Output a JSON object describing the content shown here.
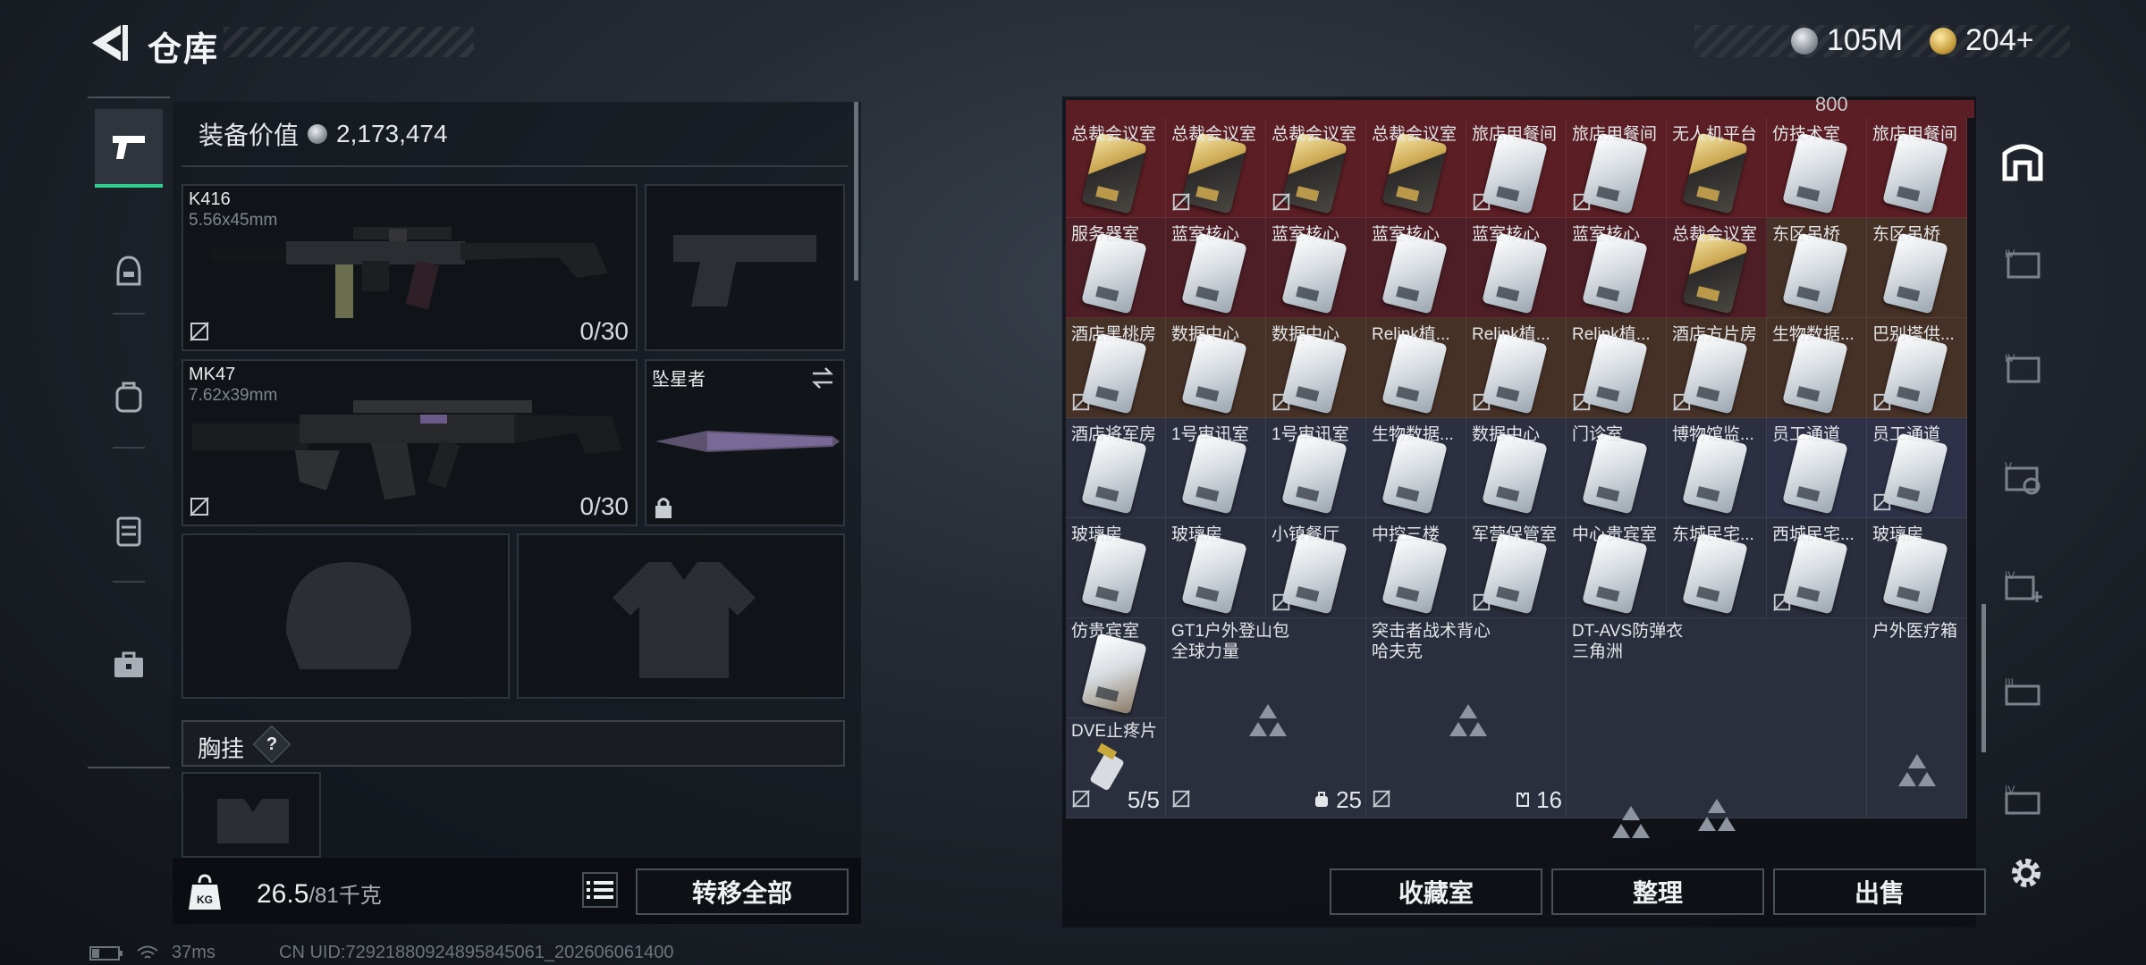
{
  "header": {
    "title": "仓库",
    "silver_amount": "105M",
    "gold_amount": "204+"
  },
  "equipment": {
    "value_label": "装备价值",
    "value": "2,173,474",
    "weapon1": {
      "name": "K416",
      "caliber": "5.56x45mm",
      "ammo": "0/30"
    },
    "weapon2": {
      "name": "MK47",
      "caliber": "7.62x39mm",
      "ammo": "0/30"
    },
    "melee": {
      "name": "坠星者"
    },
    "chest_rig_label": "胸挂",
    "help_mark": "?",
    "weight_current": "26.5",
    "weight_max": "/81千克",
    "transfer_all_label": "转移全部"
  },
  "stash": {
    "top_partial": "800",
    "rows": [
      [
        "总裁会议室",
        "总裁会议室",
        "总裁会议室",
        "总裁会议室",
        "旅店用餐间",
        "旅店用餐间",
        "无人机平台",
        "仿技术室",
        "旅店用餐间"
      ],
      [
        "服务器室",
        "蓝室核心",
        "蓝室核心",
        "蓝室核心",
        "蓝室核心",
        "蓝室核心",
        "总裁会议室",
        "东区吊桥",
        "东区吊桥"
      ],
      [
        "酒店黑桃房",
        "数据中心",
        "数据中心",
        "Relink植...",
        "Relink植...",
        "Relink植...",
        "酒店方片房",
        "生物数据...",
        "巴别塔供..."
      ],
      [
        "酒店将军房",
        "1号审讯室",
        "1号审讯室",
        "生物数据...",
        "数据中心",
        "门诊室",
        "博物馆监...",
        "员工通道",
        "员工通道"
      ],
      [
        "玻璃房",
        "玻璃房",
        "小镇餐厅",
        "中控三楼",
        "军营保管室",
        "中心贵宾室",
        "东城民宅...",
        "西城民宅...",
        "玻璃房"
      ]
    ],
    "row6": {
      "vip": "仿贵宾室",
      "backpack_name": "GT1户外登山包",
      "backpack_sub": "全球力量",
      "rig_name": "突击者战术背心",
      "rig_sub": "哈夫克",
      "armor_name": "DT-AVS防弹衣",
      "armor_sub": "三角洲",
      "medkit": "户外医疗箱"
    },
    "row7": {
      "painkiller": "DVE止疼片",
      "painkiller_count": "5/5",
      "backpack_count": "25",
      "rig_count": "16"
    },
    "buttons": {
      "collection": "收藏室",
      "sort": "整理",
      "sell": "出售"
    }
  },
  "footer": {
    "ping": "37ms",
    "uid": "CN UID:7292188092489584​5061_202606061400"
  },
  "colors": {
    "accent_green": "#2fcf8f",
    "red_row": "#5a1e24",
    "brown_row": "#4a3526",
    "purple_row": "#2e3147"
  }
}
